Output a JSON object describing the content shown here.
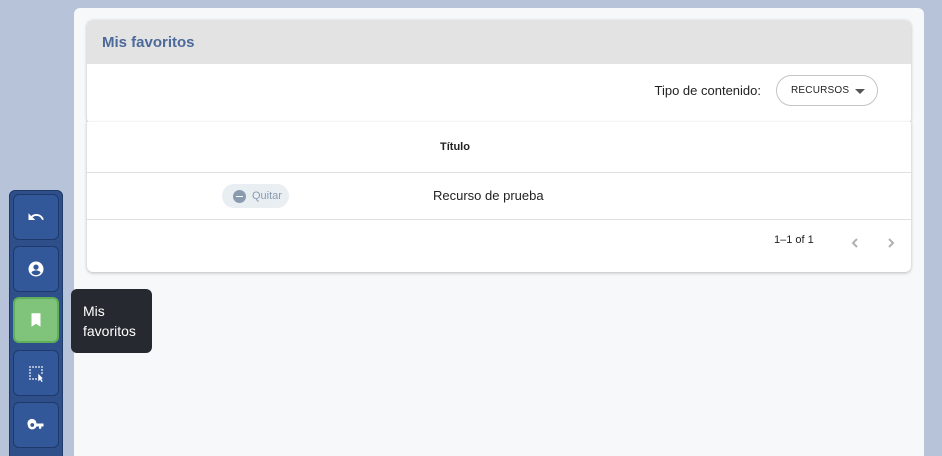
{
  "main": {
    "title": "Mis favoritos",
    "filter": {
      "label": "Tipo de contenido:",
      "selected": "RECURSOS"
    },
    "table": {
      "columns": [
        "",
        "Título"
      ],
      "rows": [
        {
          "action_label": "Quitar",
          "title": "Recurso de prueba"
        }
      ],
      "pagination": {
        "range": "1–1 of 1"
      }
    }
  },
  "sidebar": {
    "items": [
      {
        "icon": "undo-icon"
      },
      {
        "icon": "account-icon"
      },
      {
        "icon": "bookmark-icon",
        "active": true
      },
      {
        "icon": "select-area-icon"
      },
      {
        "icon": "key-icon"
      }
    ],
    "tooltip": "Mis favoritos"
  },
  "colors": {
    "accent": "#2e4f8a",
    "active": "#7fc47a",
    "title": "#4b6a9a"
  }
}
